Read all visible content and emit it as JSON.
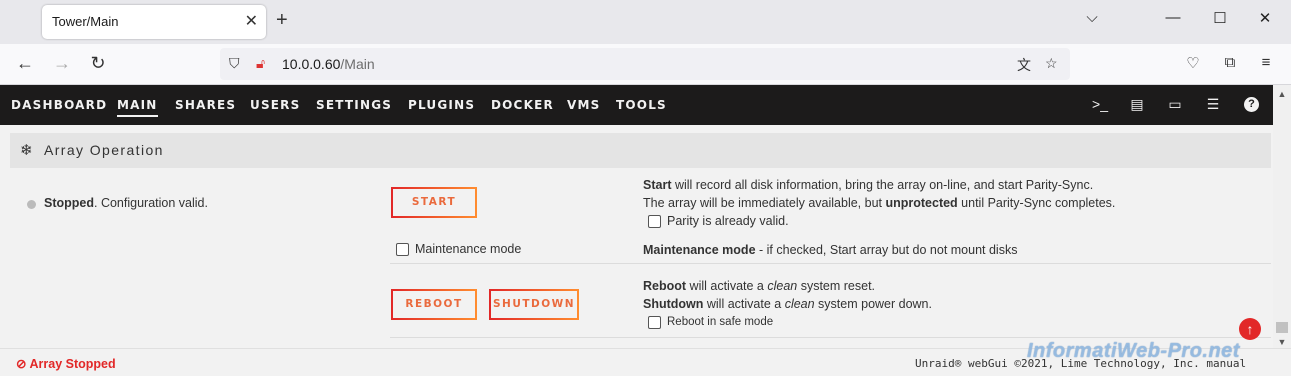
{
  "browser": {
    "tab_title": "Tower/Main",
    "url_host": "10.0.0.60",
    "url_path": "/Main"
  },
  "menu": {
    "items": [
      "DASHBOARD",
      "MAIN",
      "SHARES",
      "USERS",
      "SETTINGS",
      "PLUGINS",
      "DOCKER",
      "VMS",
      "TOOLS"
    ],
    "active": "MAIN"
  },
  "section": {
    "title": "Array Operation"
  },
  "array_status": {
    "state": "Stopped",
    "message": ". Configuration valid."
  },
  "buttons": {
    "start": "START",
    "reboot": "REBOOT",
    "shutdown": "SHUTDOWN"
  },
  "checkboxes": {
    "maintenance_mode": "Maintenance mode",
    "parity_valid": "Parity is already valid.",
    "safe_mode": "Reboot in safe mode"
  },
  "descriptions": {
    "start_bold": "Start",
    "start_text": " will record all disk information, bring the array on-line, and start Parity-Sync.",
    "available_pre": "The array will be immediately available, but ",
    "available_bold": "unprotected",
    "available_post": " until Parity-Sync completes.",
    "maint_bold": "Maintenance mode",
    "maint_text": " - if checked, Start array but do not mount disks",
    "reboot_bold": "Reboot",
    "reboot_pre": " will activate a ",
    "reboot_italic": "clean",
    "reboot_post": " system reset.",
    "shutdown_bold": "Shutdown",
    "shutdown_pre": " will activate a ",
    "shutdown_italic": "clean",
    "shutdown_post": " system power down."
  },
  "footer": {
    "array_state": "Array Stopped",
    "copyright": "Unraid® webGui ©2021, Lime Technology, Inc. manual"
  },
  "watermark": "InformatiWeb-Pro.net",
  "colors": {
    "accent_red": "#e22828",
    "accent_orange": "#ff8c2f",
    "header_bg": "#1c1b1b"
  }
}
